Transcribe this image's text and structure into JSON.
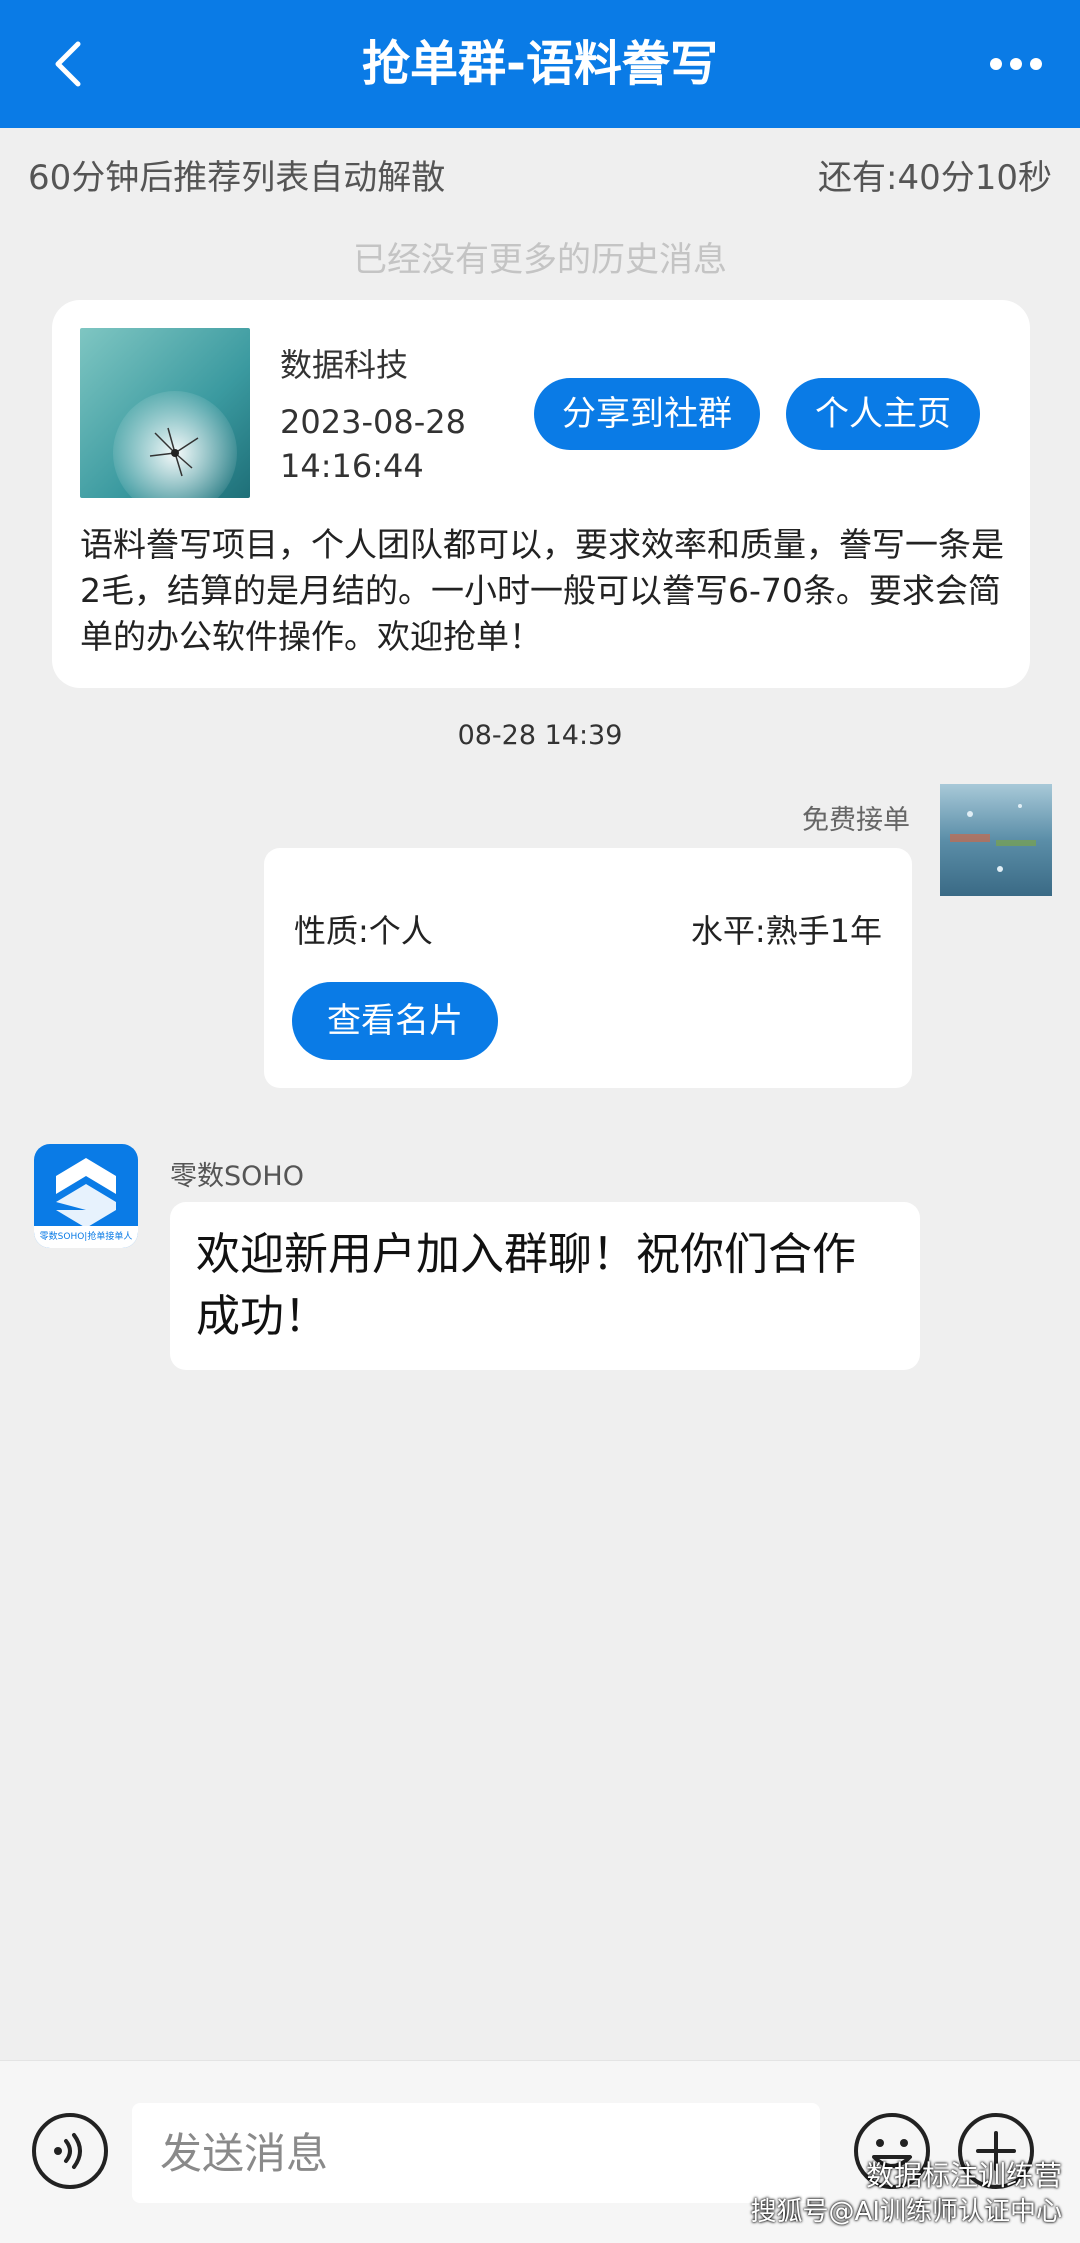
{
  "header": {
    "title": "抢单群-语料誊写",
    "back_icon": "chevron-left-icon",
    "more_icon": "more-dots-icon"
  },
  "notice": {
    "left": "60分钟后推荐列表自动解散",
    "right": "还有:40分10秒"
  },
  "no_history": "已经没有更多的历史消息",
  "post": {
    "name": "数据科技",
    "time": "2023-08-28 14:16:44",
    "share_label": "分享到社群",
    "home_label": "个人主页",
    "body": "语料誊写项目，个人团队都可以，要求效率和质量，誊写一条是2毛，结算的是月结的。一小时一般可以誊写6-70条。要求会简单的办公软件操作。欢迎抢单！"
  },
  "timestamp": "08-28 14:39",
  "right_message": {
    "sender": "免费接单",
    "nature": "性质:个人",
    "level": "水平:熟手1年",
    "card_label": "查看名片"
  },
  "left_message": {
    "sender": "零数SOHO",
    "text": "欢迎新用户加入群聊！祝你们合作成功！",
    "avatar_caption": "零数SOHO|抢单接单人"
  },
  "input": {
    "placeholder": "发送消息"
  },
  "watermark": {
    "line1": "数据标注训练营",
    "line2": "搜狐号@AI训练师认证中心"
  },
  "colors": {
    "accent": "#0a7be6",
    "background": "#efefef"
  }
}
